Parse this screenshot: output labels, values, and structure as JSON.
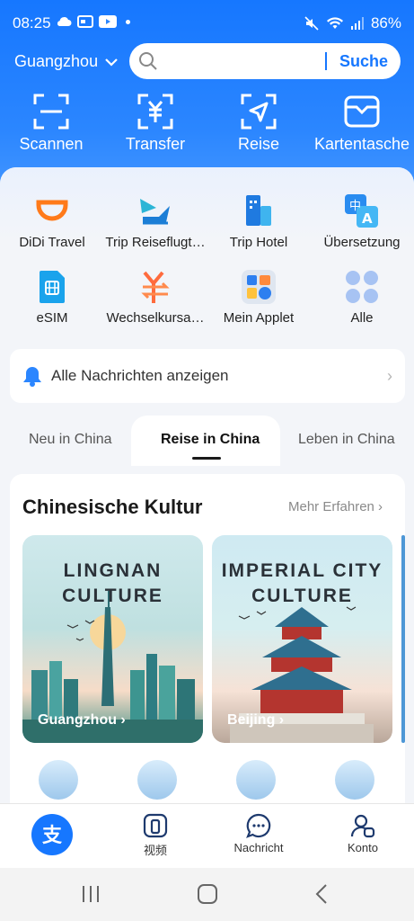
{
  "status_bar": {
    "time": "08:25",
    "battery": "86%"
  },
  "header": {
    "city": "Guangzhou",
    "search_button": "Suche",
    "search_placeholder": ""
  },
  "quick_actions": [
    {
      "label": "Scannen",
      "icon": "scan-icon"
    },
    {
      "label": "Transfer",
      "icon": "yuan-transfer-icon"
    },
    {
      "label": "Reise",
      "icon": "travel-arrow-icon"
    },
    {
      "label": "Kartentasche",
      "icon": "wallet-icon"
    }
  ],
  "services": [
    {
      "label": "DiDi Travel",
      "icon": "didi-icon"
    },
    {
      "label": "Trip Reiseflugt…",
      "icon": "plane-ticket-icon"
    },
    {
      "label": "Trip Hotel",
      "icon": "hotel-icon"
    },
    {
      "label": "Übersetzung",
      "icon": "translate-icon"
    },
    {
      "label": "eSIM",
      "icon": "esim-icon"
    },
    {
      "label": "Wechselkursa…",
      "icon": "exchange-rate-icon"
    },
    {
      "label": "Mein Applet",
      "icon": "applet-icon"
    },
    {
      "label": "Alle",
      "icon": "all-apps-icon"
    }
  ],
  "notice": {
    "text": "Alle Nachrichten anzeigen"
  },
  "tabs": [
    {
      "label": "Neu in China"
    },
    {
      "label": "Reise in China"
    },
    {
      "label": "Leben in China"
    }
  ],
  "culture": {
    "title": "Chinesische Kultur",
    "more": "Mehr Erfahren",
    "cards": [
      {
        "line1": "LINGNAN",
        "line2": "CULTURE",
        "city": "Guangzhou"
      },
      {
        "line1": "IMPERIAL CITY",
        "line2": "CULTURE",
        "city": "Beijing"
      }
    ]
  },
  "bottom_nav": [
    {
      "label": "",
      "icon": "alipay-logo-icon"
    },
    {
      "label": "视频",
      "icon": "video-icon"
    },
    {
      "label": "Nachricht",
      "icon": "message-icon"
    },
    {
      "label": "Konto",
      "icon": "account-icon"
    }
  ],
  "colors": {
    "brand": "#1677ff",
    "background": "#f3f5f9"
  }
}
